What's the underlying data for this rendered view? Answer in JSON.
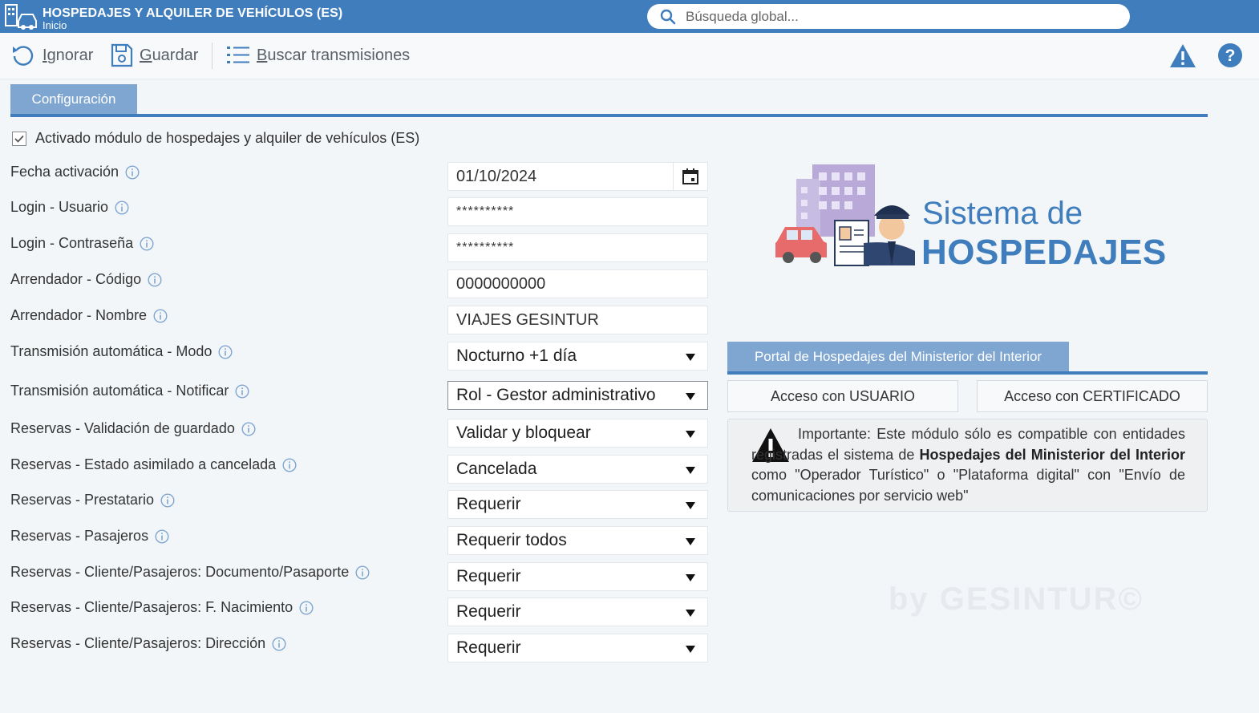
{
  "header": {
    "title": "HOSPEDAJES Y ALQUILER DE VEHÍCULOS (ES)",
    "subtitle": "Inicio",
    "search_placeholder": "Búsqueda global..."
  },
  "toolbar": {
    "ignore_label": "Ignorar",
    "save_label": "Guardar",
    "search_transmissions_label": "Buscar transmisiones"
  },
  "tabs": [
    {
      "label": "Configuración"
    }
  ],
  "module": {
    "checkbox_label": "Activado módulo de hospedajes y alquiler de vehículos (ES)",
    "checked": true
  },
  "fields": {
    "fecha": {
      "label": "Fecha activación",
      "value": "01/10/2024"
    },
    "login_user": {
      "label": "Login - Usuario",
      "value": "**********"
    },
    "login_pass": {
      "label": "Login - Contraseña",
      "value": "**********"
    },
    "arr_codigo": {
      "label": "Arrendador - Código",
      "value": "0000000000"
    },
    "arr_nombre": {
      "label": "Arrendador - Nombre",
      "value": "VIAJES GESINTUR"
    },
    "trans_modo": {
      "label": "Transmisión automática - Modo",
      "value": "Nocturno +1 día"
    },
    "trans_notif": {
      "label": "Transmisión automática - Notificar",
      "value": "Rol - Gestor administrativo"
    },
    "res_valid": {
      "label": "Reservas - Validación de guardado",
      "value": "Validar y bloquear"
    },
    "res_estado": {
      "label": "Reservas - Estado asimilado a cancelada",
      "value": "Cancelada"
    },
    "res_prest": {
      "label": "Reservas - Prestatario",
      "value": "Requerir"
    },
    "res_pasaj": {
      "label": "Reservas - Pasajeros",
      "value": "Requerir todos"
    },
    "res_doc": {
      "label": "Reservas - Cliente/Pasajeros: Documento/Pasaporte",
      "value": "Requerir"
    },
    "res_nac": {
      "label": "Reservas - Cliente/Pasajeros: F. Nacimiento",
      "value": "Requerir"
    },
    "res_dir": {
      "label": "Reservas - Cliente/Pasajeros: Dirección",
      "value": "Requerir"
    }
  },
  "logo": {
    "line1": "Sistema de",
    "line2": "HOSPEDAJES"
  },
  "portal": {
    "tab_label": "Portal de Hospedajes del Ministerior del Interior",
    "usuario_button": "Acceso con USUARIO",
    "certificado_button": "Acceso con CERTIFICADO",
    "notice": {
      "part1": "Importante: Este módulo sólo es compatible con entidades registradas el sistema de ",
      "bold": "Hospedajes del Ministerior del Interior",
      "part2": " como \"Operador Turístico\" o \"Plataforma digital\" con \"Envío de comunicaciones por servicio web\""
    }
  },
  "watermark": "by GESINTUR©",
  "colors": {
    "primary": "#3f7dbd",
    "tab": "#7fa6d0"
  }
}
